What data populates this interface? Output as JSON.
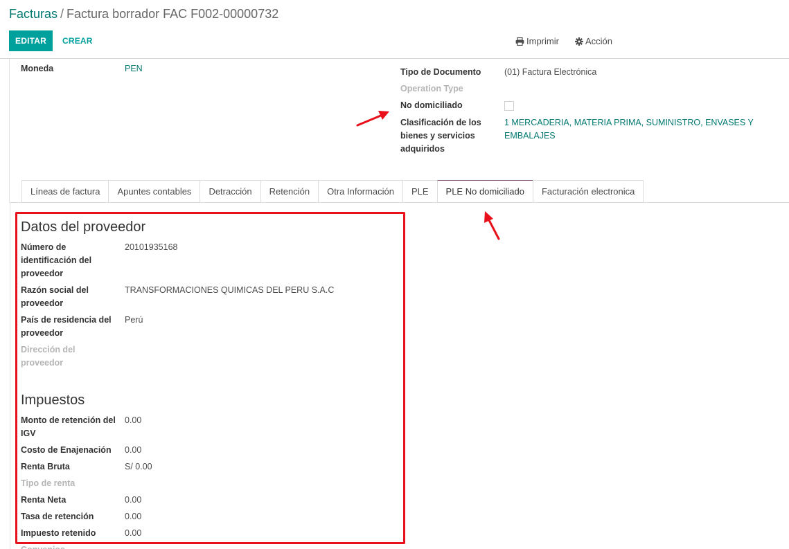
{
  "breadcrumb": {
    "parent": "Facturas",
    "separator": "/",
    "current": "Factura borrador FAC F002-00000732"
  },
  "toolbar": {
    "edit_label": "EDITAR",
    "create_label": "CREAR",
    "print_label": "Imprimir",
    "print_icon": "print-icon",
    "action_label": "Acción",
    "action_icon": "gear-icon"
  },
  "header_fields": {
    "currency_label": "Moneda",
    "currency_value": "PEN",
    "doc_type_label": "Tipo de Documento",
    "doc_type_value": "(01) Factura Electrónica",
    "operation_type_label": "Operation Type",
    "no_domiciled_label": "No domiciliado",
    "no_domiciled_checked": false,
    "classification_label_1": "Clasificación de los",
    "classification_label_2": "bienes y servicios",
    "classification_label_3": "adquiridos",
    "classification_value_1": "1 MERCADERIA, MATERIA PRIMA, SUMINISTRO, ENVASES Y",
    "classification_value_2": "EMBALAJES"
  },
  "tabs": [
    {
      "label": "Líneas de factura",
      "active": false
    },
    {
      "label": "Apuntes contables",
      "active": false
    },
    {
      "label": "Detracción",
      "active": false
    },
    {
      "label": "Retención",
      "active": false
    },
    {
      "label": "Otra Información",
      "active": false
    },
    {
      "label": "PLE",
      "active": false
    },
    {
      "label": "PLE No domiciliado",
      "active": true
    },
    {
      "label": "Facturación electronica",
      "active": false
    }
  ],
  "supplier": {
    "title": "Datos del proveedor",
    "id_label_1": "Número de",
    "id_label_2": "identificación del",
    "id_label_3": "proveedor",
    "id_value": "20101935168",
    "name_label_1": "Razón social del",
    "name_label_2": "proveedor",
    "name_value": "TRANSFORMACIONES QUIMICAS DEL PERU S.A.C",
    "country_label_1": "País de residencia del",
    "country_label_2": "proveedor",
    "country_value": "Perú",
    "address_label_1": "Dirección del",
    "address_label_2": "proveedor"
  },
  "taxes": {
    "title": "Impuestos",
    "igv_label_1": "Monto de retención del",
    "igv_label_2": "IGV",
    "igv_value": "0.00",
    "disposal_label": "Costo de Enajenación",
    "disposal_value": "0.00",
    "gross_label": "Renta Bruta",
    "gross_value": "S/ 0.00",
    "income_type_label": "Tipo de renta",
    "net_label": "Renta Neta",
    "net_value": "0.00",
    "rate_label": "Tasa de retención",
    "rate_value": "0.00",
    "withheld_label": "Impuesto retenido",
    "withheld_value": "0.00",
    "cut_off_label": "Convenios"
  },
  "colors": {
    "accent": "#00a09d",
    "link": "#00786f",
    "annotation_red": "#e8101a",
    "active_tab_border": "#7b4f75"
  }
}
